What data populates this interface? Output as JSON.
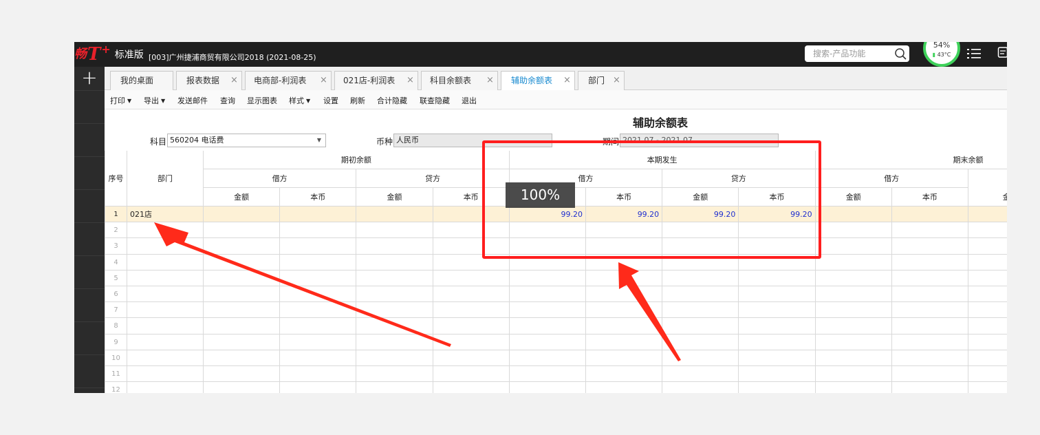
{
  "header": {
    "logo_prefix": "畅",
    "logo_mark": "T",
    "logo_plus": "+",
    "edition": "标准版",
    "company": "[003]广州捷浦商贸有限公司2018   (2021-08-25)"
  },
  "search": {
    "placeholder": "搜索-产品功能"
  },
  "sys_monitor": {
    "cpu": "54%",
    "temp": "43°C"
  },
  "colors": {
    "accent": "#1a8bd0",
    "highlight_row": "#fdf1d6",
    "annotation": "#ff1e1e",
    "brand": "#e8202a"
  },
  "leftbar": {
    "add": "+"
  },
  "tabs": [
    {
      "label": "我的桌面",
      "closable": false
    },
    {
      "label": "报表数据",
      "closable": true
    },
    {
      "label": "电商部-利润表",
      "closable": true
    },
    {
      "label": "021店-利润表",
      "closable": true
    },
    {
      "label": "科目余额表",
      "closable": true
    },
    {
      "label": "辅助余额表",
      "closable": true,
      "active": true
    },
    {
      "label": "部门",
      "closable": true
    }
  ],
  "toolbar": [
    {
      "label": "打印",
      "dropdown": true
    },
    {
      "label": "导出",
      "dropdown": true
    },
    {
      "label": "发送邮件"
    },
    {
      "label": "查询"
    },
    {
      "label": "显示图表"
    },
    {
      "label": "样式",
      "dropdown": true
    },
    {
      "label": "设置"
    },
    {
      "label": "刷新"
    },
    {
      "label": "合计隐藏"
    },
    {
      "label": "联查隐藏"
    },
    {
      "label": "退出"
    }
  ],
  "report": {
    "title": "辅助余额表",
    "subject_label": "科目",
    "subject_value": "560204 电话费",
    "currency_label": "币种",
    "currency_value": "人民币",
    "period_label": "期间",
    "period_value": "2021.07 - 2021.07"
  },
  "table": {
    "seq_header": "序号",
    "dept_header": "部门",
    "groups": [
      "期初余额",
      "本期发生",
      "期末余额"
    ],
    "sides": [
      "借方",
      "贷方",
      "借方",
      "贷方",
      "借方"
    ],
    "cols": [
      "金额",
      "本币",
      "金额",
      "本币",
      "金额",
      "本币",
      "金额",
      "本币",
      "金额",
      "本币",
      "金"
    ],
    "rows": [
      {
        "seq": "1",
        "dept": "021店",
        "values": [
          "",
          "",
          "",
          "",
          "99.20",
          "99.20",
          "99.20",
          "99.20",
          "",
          "",
          ""
        ]
      },
      {
        "seq": "2"
      },
      {
        "seq": "3"
      },
      {
        "seq": "4"
      },
      {
        "seq": "5"
      },
      {
        "seq": "6"
      },
      {
        "seq": "7"
      },
      {
        "seq": "8"
      },
      {
        "seq": "9"
      },
      {
        "seq": "10"
      },
      {
        "seq": "11"
      },
      {
        "seq": "12"
      }
    ]
  },
  "zoom_toast": "100%"
}
